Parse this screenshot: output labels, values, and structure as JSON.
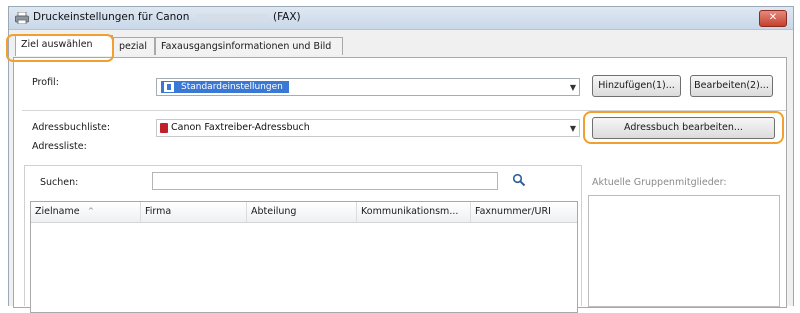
{
  "window": {
    "title_prefix": "Druckeinstellungen für Canon",
    "title_suffix": "(FAX)",
    "close_label": "✕"
  },
  "tabs": [
    {
      "label": "Ziel auswählen"
    },
    {
      "label": "pezial"
    },
    {
      "label": "Faxausgangsinformationen und Bild"
    }
  ],
  "profile": {
    "label": "Profil:",
    "value": "Standardeinstellungen",
    "add_button": "Hinzufügen(1)...",
    "edit_button": "Bearbeiten(2)..."
  },
  "addressbook": {
    "list_label": "Adressbuchliste:",
    "value": "Canon Faxtreiber-Adressbuch",
    "edit_button": "Adressbuch bearbeiten...",
    "address_list_label": "Adressliste:"
  },
  "search": {
    "label": "Suchen:",
    "value": ""
  },
  "table": {
    "columns": [
      "Zielname",
      "Firma",
      "Abteilung",
      "Kommunikationsm...",
      "Faxnummer/URI"
    ]
  },
  "group_members": {
    "label": "Aktuelle Gruppenmitglieder:"
  }
}
